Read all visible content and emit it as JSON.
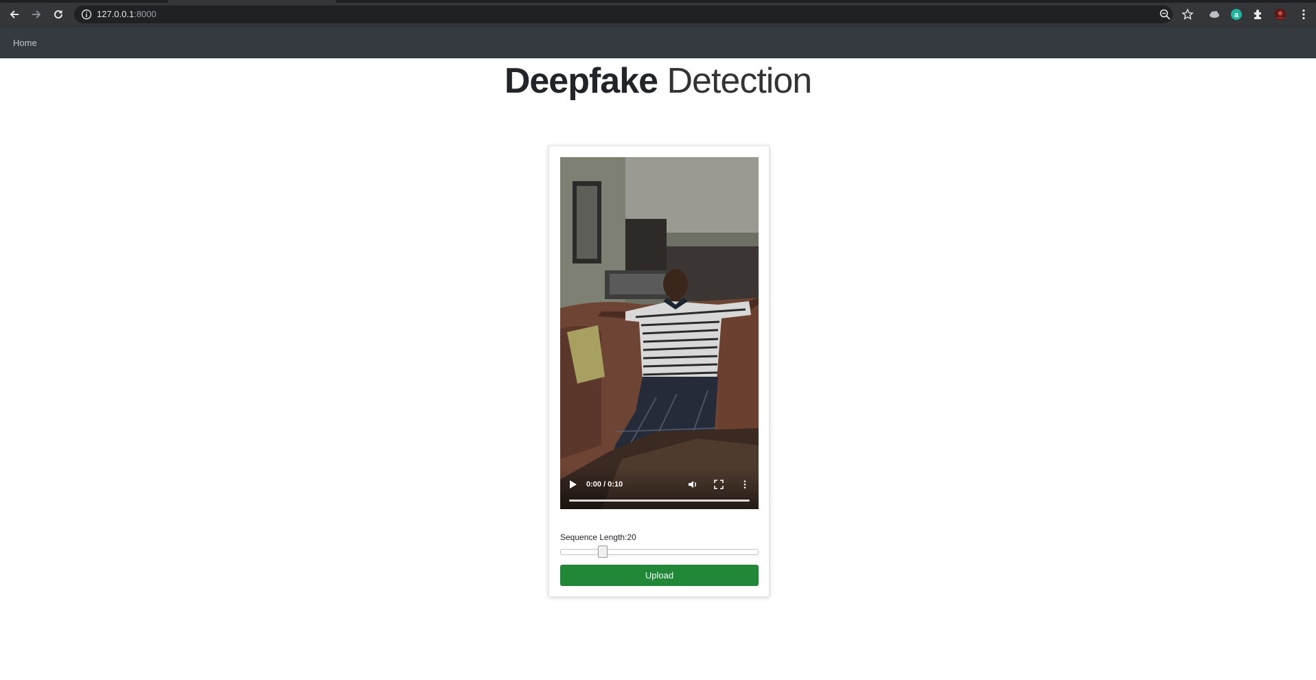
{
  "browser": {
    "url_host": "127.0.0.1",
    "url_port": ":8000"
  },
  "nav": {
    "home_label": "Home"
  },
  "title": {
    "bold": "Deepfake",
    "light": "Detection"
  },
  "video": {
    "time": "0:00 / 0:10"
  },
  "form": {
    "sequence_label": "Sequence Length:",
    "sequence_value": "20",
    "sequence_fraction": 0.2,
    "upload_label": "Upload"
  },
  "colors": {
    "navbar": "#343a40",
    "upload_button": "#218838"
  },
  "icons": [
    "back-icon",
    "forward-icon",
    "reload-icon",
    "info-icon",
    "zoom-icon",
    "star-icon",
    "extension-icon",
    "profile-avatar",
    "menu-icon",
    "play-icon",
    "volume-icon",
    "fullscreen-icon",
    "more-icon"
  ]
}
